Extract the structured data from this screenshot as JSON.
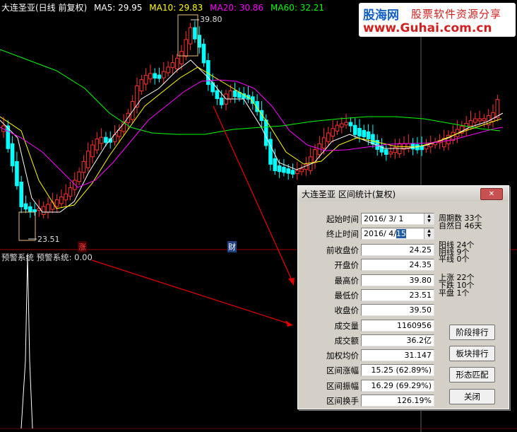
{
  "header": {
    "stock": "大连圣亚(日线 前复权)",
    "ma5": "MA5: 29.95",
    "ma10": "MA10: 29.83",
    "ma20": "MA20: 30.86",
    "ma60": "MA60: 32.21"
  },
  "colors": {
    "ma5": "#ffffff",
    "ma10": "#ffff00",
    "ma20": "#ff00ff",
    "ma60": "#00ff00",
    "up": "#ff3232",
    "down": "#00ffff",
    "arrow": "#e00000"
  },
  "logo": {
    "name": "股海网",
    "slogan": "股票软件资源分享",
    "url": "www.Guhai.com.cn"
  },
  "chart_marks": {
    "high": "39.80",
    "low": "23.51",
    "zhang": "涨",
    "cai": "财"
  },
  "indicator": {
    "title": "预警系统 预警系统: 0.00"
  },
  "dialog": {
    "title": "大连圣亚 区间统计(复权)",
    "close": "✕",
    "start_label": "起始时间",
    "start_value": "2016/ 3/ 1",
    "end_label": "终止时间",
    "end_value_prefix": "2016/ 4/",
    "end_value_day": "15",
    "fields": [
      {
        "label": "前收盘价",
        "value": "24.25"
      },
      {
        "label": "开盘价",
        "value": "24.35"
      },
      {
        "label": "最高价",
        "value": "39.80"
      },
      {
        "label": "最低价",
        "value": "23.51"
      },
      {
        "label": "收盘价",
        "value": "39.50"
      },
      {
        "label": "成交量",
        "value": "1160956"
      },
      {
        "label": "成交额",
        "value": "36.2亿"
      },
      {
        "label": "加权均价",
        "value": "31.147"
      },
      {
        "label": "区间涨幅",
        "value": "15.25 (62.89%)"
      },
      {
        "label": "区间振幅",
        "value": "16.29 (69.29%)"
      },
      {
        "label": "区间换手",
        "value": "126.19%"
      }
    ],
    "period": {
      "week": "周期数 33个",
      "day": "自然日 46天"
    },
    "lines": {
      "yang": "阳线 24个",
      "yin": "阴线 9个",
      "ping": "平线 0个"
    },
    "moves": {
      "up": "上涨 22个",
      "down": "下跌 10个",
      "flat": "平盘 1个"
    },
    "buttons": {
      "stage": "阶段排行",
      "sector": "板块排行",
      "pattern": "形态匹配",
      "close": "关闭"
    }
  }
}
